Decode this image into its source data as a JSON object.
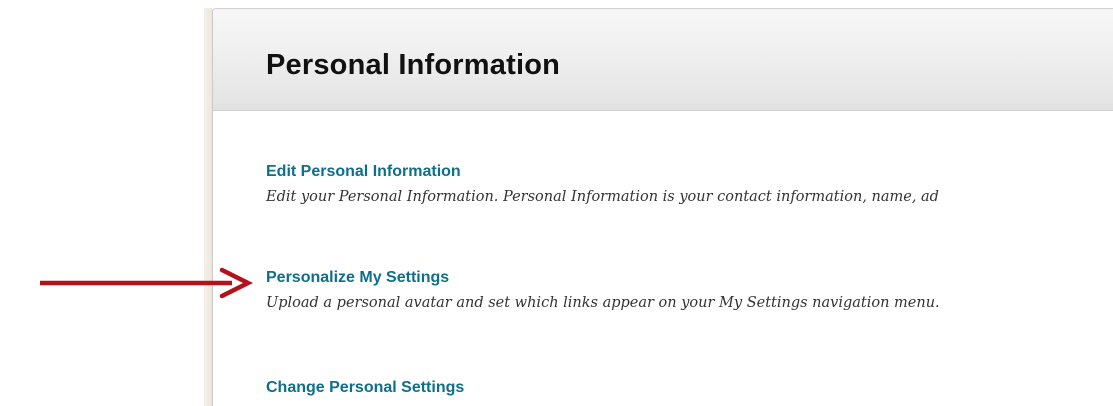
{
  "panel": {
    "title": "Personal Information"
  },
  "items": [
    {
      "link": "Edit Personal Information",
      "description": "Edit your Personal Information. Personal Information is your contact information, name, ad"
    },
    {
      "link": "Personalize My Settings",
      "description": "Upload a personal avatar and set which links appear on your My Settings navigation menu."
    },
    {
      "link": "Change Personal Settings",
      "description": ""
    }
  ],
  "annotation": {
    "arrow_color": "#b3121b",
    "arrow_target": "Personalize My Settings"
  },
  "colors": {
    "link": "#0e6f8a",
    "header_bg": "#ededed",
    "title": "#111111"
  }
}
